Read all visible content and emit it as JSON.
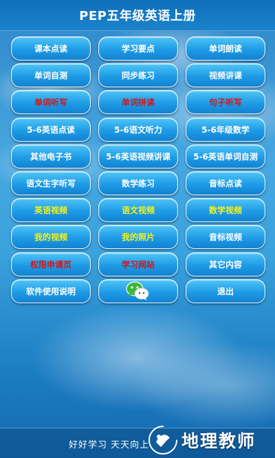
{
  "header": {
    "title": "PEP五年级英语上册"
  },
  "menu": {
    "buttons": [
      {
        "label": "课本点读",
        "color": "#ffffff"
      },
      {
        "label": "学习要点",
        "color": "#ffffff"
      },
      {
        "label": "单词朗读",
        "color": "#ffffff"
      },
      {
        "label": "单词自测",
        "color": "#ffffff"
      },
      {
        "label": "同步练习",
        "color": "#ffffff"
      },
      {
        "label": "视频讲课",
        "color": "#ffffff"
      },
      {
        "label": "单词听写",
        "color": "#d81414"
      },
      {
        "label": "单词拼读",
        "color": "#d81414"
      },
      {
        "label": "句子听写",
        "color": "#d81414"
      },
      {
        "label": "5-6英语点读",
        "color": "#ffffff"
      },
      {
        "label": "5-6语文听力",
        "color": "#ffffff"
      },
      {
        "label": "5-6年级数学",
        "color": "#ffffff"
      },
      {
        "label": "其他电子书",
        "color": "#ffffff"
      },
      {
        "label": "5-6英语视频讲课",
        "color": "#ffffff"
      },
      {
        "label": "5-6英语单词自测",
        "color": "#ffffff"
      },
      {
        "label": "语文生字听写",
        "color": "#ffffff"
      },
      {
        "label": "数学练习",
        "color": "#ffffff"
      },
      {
        "label": "音标点读",
        "color": "#ffffff"
      },
      {
        "label": "英语视频",
        "color": "#f5f21a"
      },
      {
        "label": "语文视频",
        "color": "#f5f21a"
      },
      {
        "label": "数学视频",
        "color": "#f5f21a"
      },
      {
        "label": "我的视频",
        "color": "#f5f21a"
      },
      {
        "label": "我的照片",
        "color": "#f5f21a"
      },
      {
        "label": "音标视频",
        "color": "#ffffff"
      },
      {
        "label": "权限申请页",
        "color": "#d81414"
      },
      {
        "label": "学习网站",
        "color": "#d81414"
      },
      {
        "label": "其它内容",
        "color": "#ffffff"
      },
      {
        "label": "软件使用说明",
        "color": "#ffffff"
      },
      {
        "label": "",
        "icon": "wechat-icon"
      },
      {
        "label": "退出",
        "color": "#ffffff"
      }
    ]
  },
  "footer": {
    "text": "好好学习  天天向上",
    "watermark": "地理教师"
  }
}
